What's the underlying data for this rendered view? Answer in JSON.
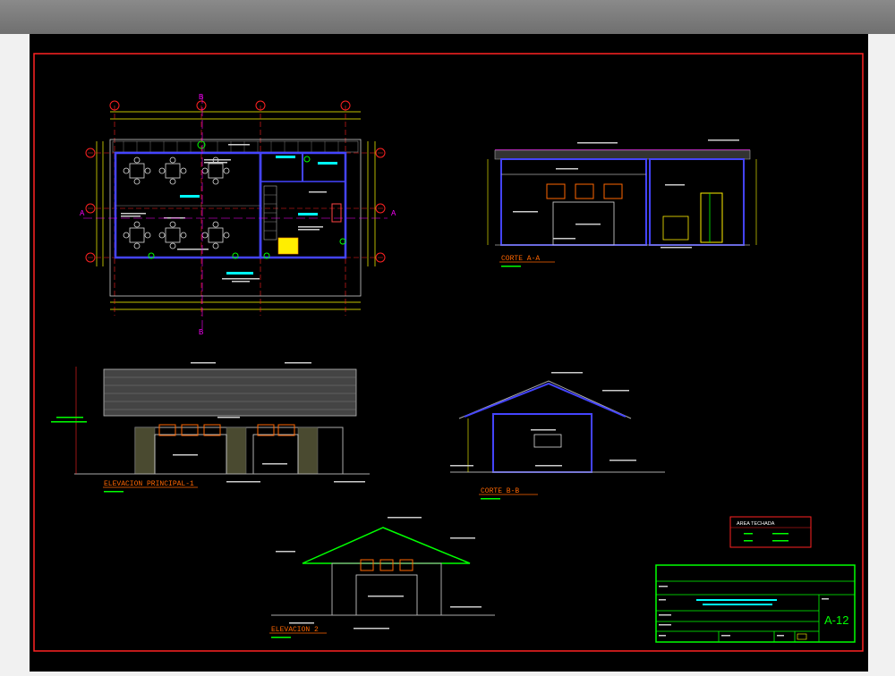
{
  "drawing": {
    "views": {
      "corte_aa": {
        "title": "CORTE  A-A"
      },
      "elevacion_principal": {
        "title": "ELEVACION  PRINCIPAL-1"
      },
      "corte_bb": {
        "title": "CORTE  B-B"
      },
      "elevacion_2": {
        "title": "ELEVACION  2"
      }
    },
    "area_box": {
      "title": "AREA  TECHADA"
    },
    "title_block": {
      "sheet_number": "A-12"
    },
    "section_markers": [
      "A",
      "A",
      "B",
      "B"
    ]
  },
  "colors": {
    "background": "#000000",
    "frame": "#ff2222",
    "walls": "#4444ff",
    "dimension": "#ffff00",
    "annotation": "#ff00ff",
    "title_block": "#00ff00",
    "text": "#ffffff"
  }
}
